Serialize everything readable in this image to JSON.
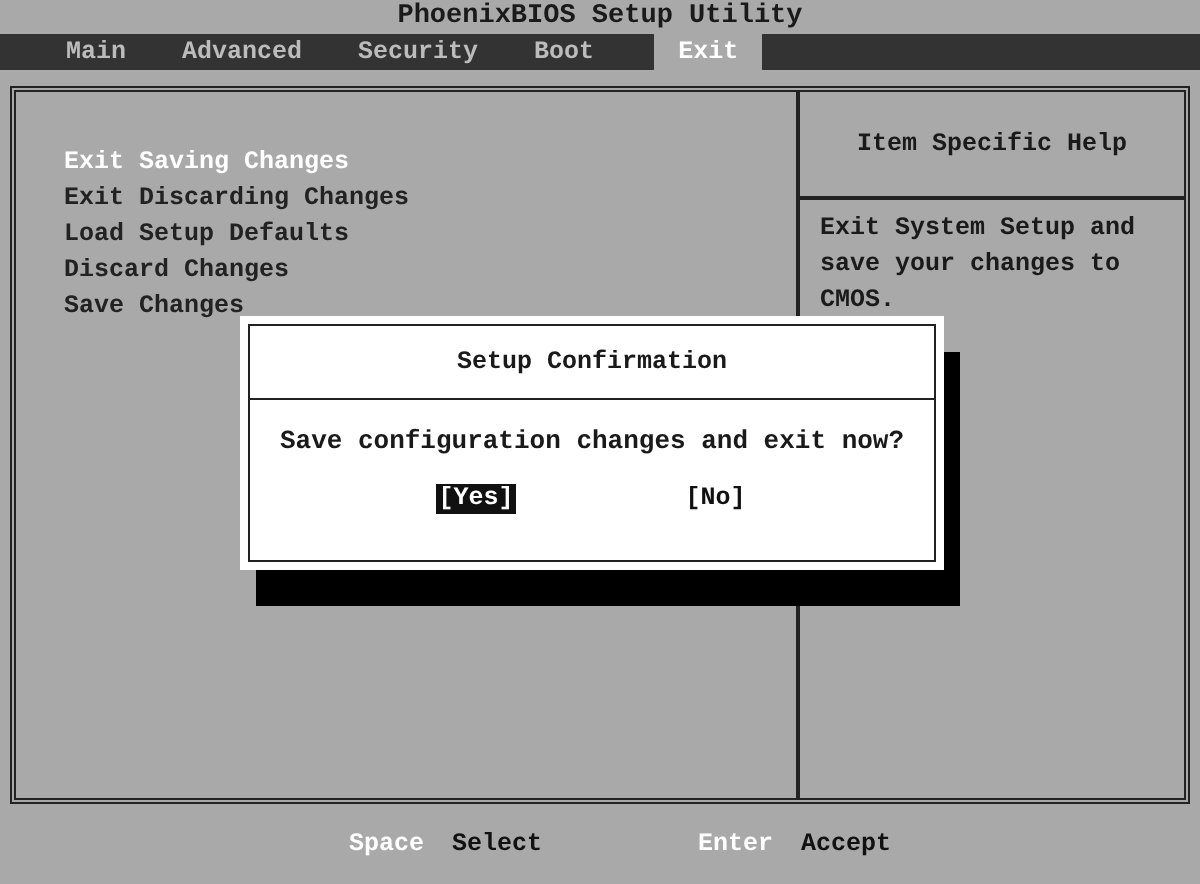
{
  "window": {
    "title": "PhoenixBIOS Setup Utility"
  },
  "tabs": [
    {
      "label": "Main",
      "selected": false
    },
    {
      "label": "Advanced",
      "selected": false
    },
    {
      "label": "Security",
      "selected": false
    },
    {
      "label": "Boot",
      "selected": false
    },
    {
      "label": "Exit",
      "selected": true
    }
  ],
  "menu_items": [
    {
      "label": "Exit Saving Changes",
      "selected": true
    },
    {
      "label": "Exit Discarding Changes",
      "selected": false
    },
    {
      "label": "Load Setup Defaults",
      "selected": false
    },
    {
      "label": "Discard Changes",
      "selected": false
    },
    {
      "label": "Save Changes",
      "selected": false
    }
  ],
  "help": {
    "title": "Item Specific Help",
    "text": "Exit System Setup and save your changes to CMOS."
  },
  "dialog": {
    "title": "Setup Confirmation",
    "message": "Save configuration changes and exit now?",
    "buttons": [
      {
        "label": "[Yes]",
        "selected": true
      },
      {
        "label": "[No]",
        "selected": false
      }
    ]
  },
  "footer": [
    {
      "key": "Space",
      "action": "Select"
    },
    {
      "key": "Enter",
      "action": "Accept"
    }
  ]
}
